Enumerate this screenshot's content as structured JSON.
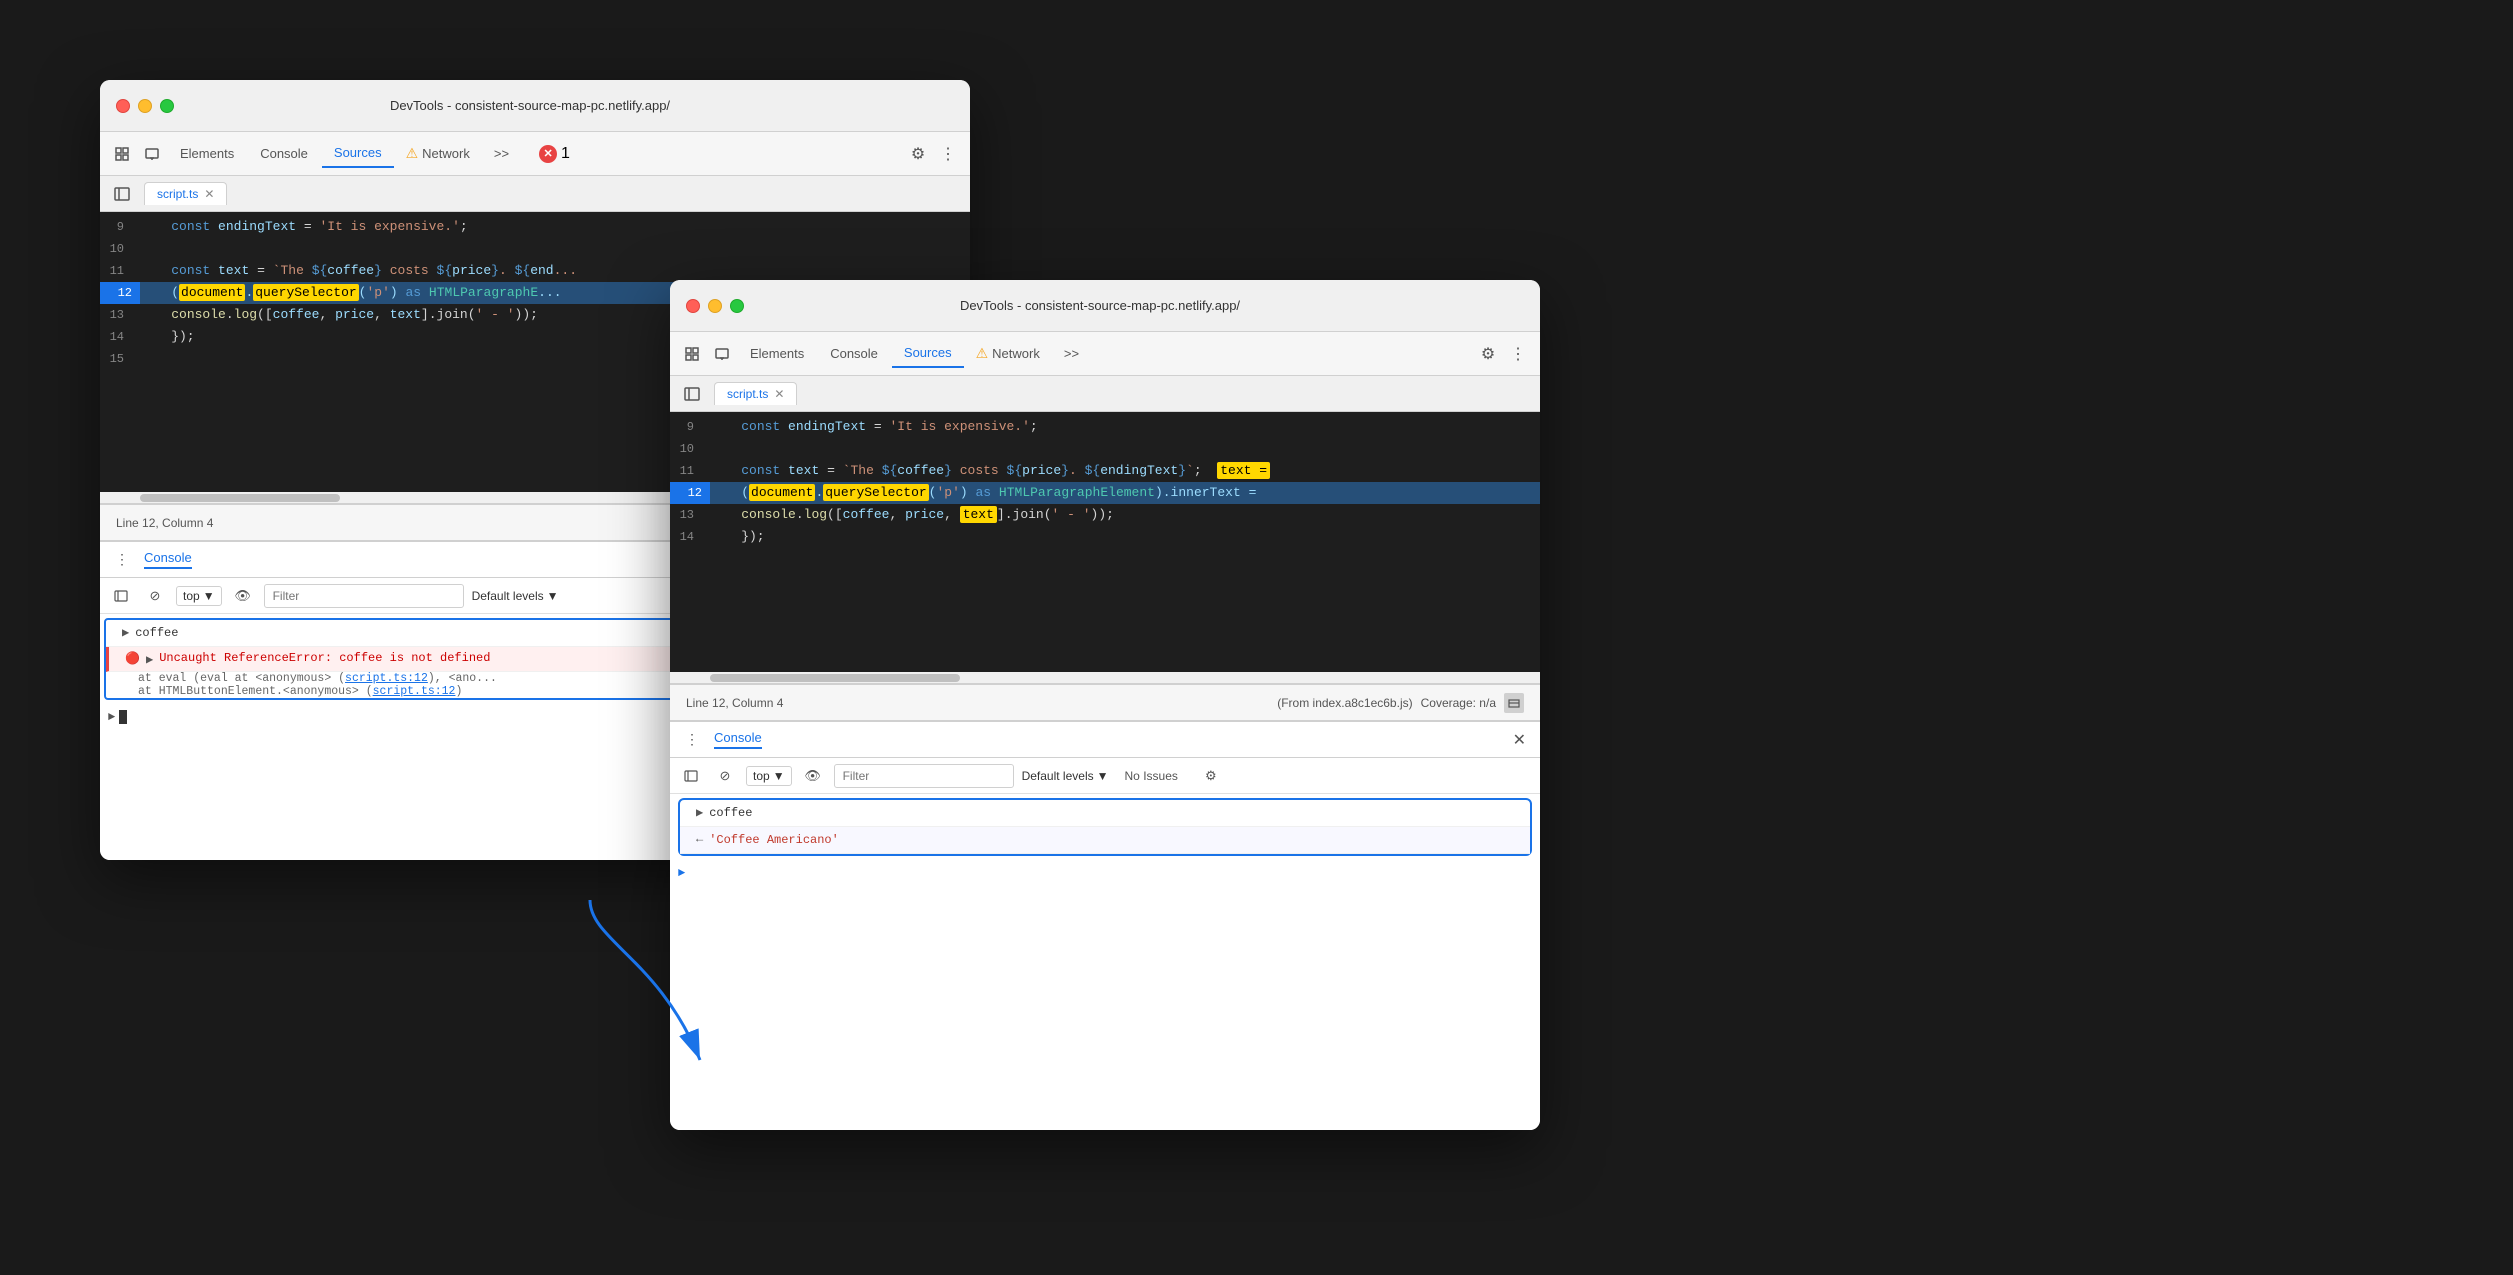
{
  "window1": {
    "title": "DevTools - consistent-source-map-pc.netlify.app/",
    "tabs": [
      "Elements",
      "Console",
      "Sources",
      "Network"
    ],
    "active_tab": "Sources",
    "file_tab": "script.ts",
    "code_lines": [
      {
        "num": 9,
        "content": "    const endingText = 'It is expensive.';"
      },
      {
        "num": 10,
        "content": ""
      },
      {
        "num": 11,
        "content": "    const text = `The ${coffee} costs ${price}. ${end..."
      },
      {
        "num": 12,
        "content": "    (document.querySelector('p') as HTMLParagraphE..."
      },
      {
        "num": 13,
        "content": "    console.log([coffee, price, text].join(' - '));"
      },
      {
        "num": 14,
        "content": "    });"
      },
      {
        "num": 15,
        "content": ""
      }
    ],
    "status": "Line 12, Column 4",
    "from_text": "(From index.a8c1ec6b.js",
    "console": {
      "title": "Console",
      "filter_placeholder": "Filter",
      "default_levels": "Default levels",
      "entries": [
        {
          "type": "expand",
          "text": "coffee"
        },
        {
          "type": "error",
          "text": "Uncaught ReferenceError: coffee is not defined"
        },
        {
          "type": "trace",
          "text": "at eval (eval at <anonymous> (script.ts:12)",
          "link": "script.ts:12"
        },
        {
          "type": "trace2",
          "text": "at HTMLButtonElement.<anonymous>",
          "link": "script.ts:12"
        }
      ]
    }
  },
  "window2": {
    "title": "DevTools - consistent-source-map-pc.netlify.app/",
    "tabs": [
      "Elements",
      "Console",
      "Sources",
      "Network"
    ],
    "active_tab": "Sources",
    "file_tab": "script.ts",
    "code_lines": [
      {
        "num": 9,
        "content": "    const endingText = 'It is expensive.';"
      },
      {
        "num": 10,
        "content": ""
      },
      {
        "num": 11,
        "content": "    const text = `The ${coffee} costs ${price}. ${endingText}`;  text ="
      },
      {
        "num": 12,
        "content": "    (document.querySelector('p') as HTMLParagraphElement).innerText ="
      },
      {
        "num": 13,
        "content": "    console.log([coffee, price, text].join(' - '));"
      },
      {
        "num": 14,
        "content": "    });"
      }
    ],
    "status": "Line 12, Column 4",
    "from_text": "(From index.a8c1ec6b.js)",
    "coverage": "Coverage: n/a",
    "console": {
      "title": "Console",
      "filter_placeholder": "Filter",
      "default_levels": "Default levels",
      "no_issues": "No Issues",
      "entries": [
        {
          "type": "expand",
          "text": "coffee"
        },
        {
          "type": "result",
          "text": "'Coffee Americano'"
        }
      ]
    }
  },
  "icons": {
    "chevron": "▼",
    "close": "✕",
    "gear": "⚙",
    "more": "⋮",
    "warn": "⚠",
    "error_x": "✕",
    "expand": "▶",
    "result_arrow": "←",
    "ban": "⊘",
    "eye": "👁",
    "sidebar": "⊞",
    "no_entry": "🚫"
  }
}
